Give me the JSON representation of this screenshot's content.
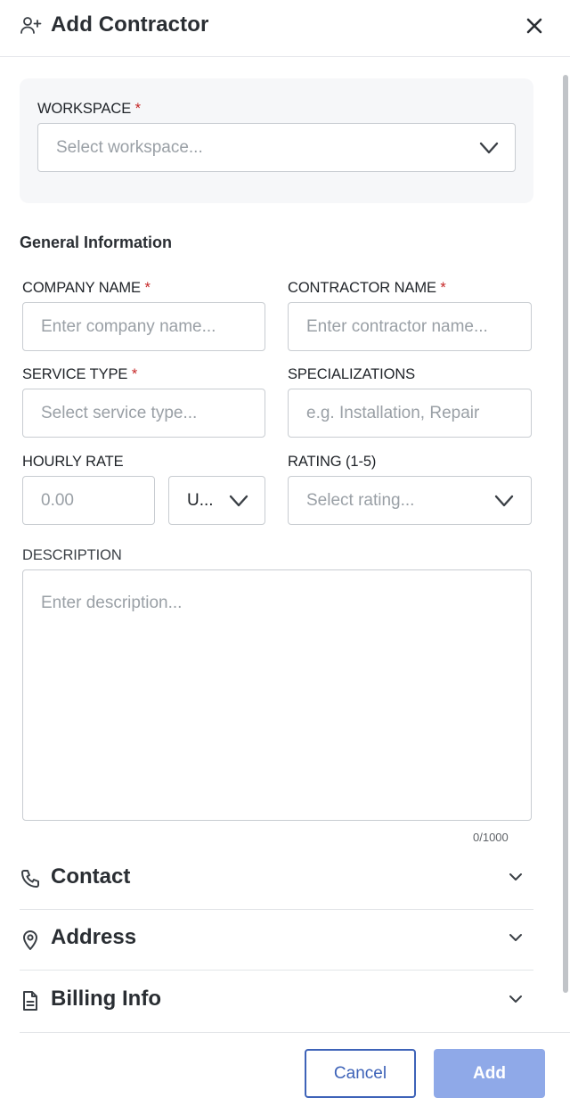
{
  "header": {
    "title": "Add Contractor",
    "icon": "user-plus-icon",
    "close_icon": "close-icon"
  },
  "workspace": {
    "label": "WORKSPACE",
    "required_mark": "*",
    "placeholder": "Select workspace..."
  },
  "general": {
    "title": "General Information",
    "company_name": {
      "label": "COMPANY NAME",
      "required_mark": "*",
      "placeholder": "Enter company name..."
    },
    "contractor_name": {
      "label": "CONTRACTOR NAME",
      "required_mark": "*",
      "placeholder": "Enter contractor name..."
    },
    "service_type": {
      "label": "SERVICE TYPE",
      "required_mark": "*",
      "placeholder": "Select service type..."
    },
    "specializations": {
      "label": "SPECIALIZATIONS",
      "placeholder": "e.g. Installation, Repair"
    },
    "hourly_rate": {
      "label": "HOURLY RATE",
      "placeholder": "0.00",
      "currency_value": "U..."
    },
    "rating": {
      "label": "RATING (1-5)",
      "placeholder": "Select rating..."
    },
    "description": {
      "label": "DESCRIPTION",
      "placeholder": "Enter description...",
      "counter": "0/1000"
    }
  },
  "sections": [
    {
      "name": "Contact",
      "icon": "phone-icon"
    },
    {
      "name": "Address",
      "icon": "location-pin-icon"
    },
    {
      "name": "Billing Info",
      "icon": "document-icon"
    }
  ],
  "footer": {
    "cancel_label": "Cancel",
    "add_label": "Add"
  },
  "colors": {
    "primary": "#3e63b8",
    "primary_disabled": "#8fa9e8",
    "required": "#c62828",
    "card_bg": "#f6f7f9",
    "border": "#c8ccd1"
  }
}
